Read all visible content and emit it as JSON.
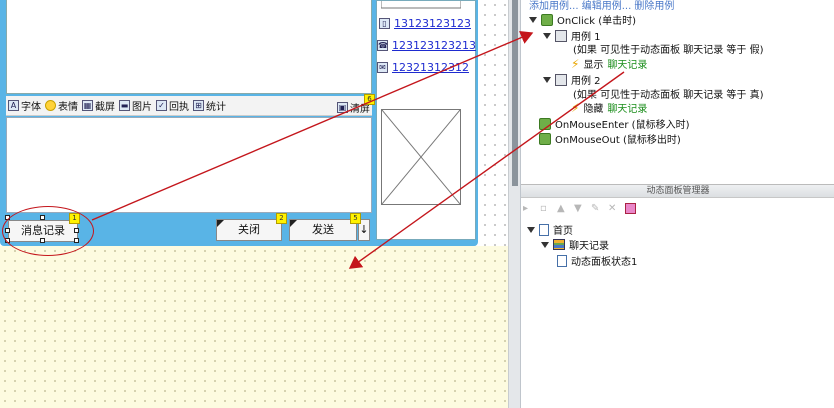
{
  "toolbar": {
    "font": "字体",
    "emoji": "表情",
    "screenshot": "截屏",
    "image": "图片",
    "receipt": "回执",
    "stats": "统计",
    "clear": "清屏"
  },
  "contacts": [
    {
      "icon": "mobile-phone-icon",
      "value": "13123123123"
    },
    {
      "icon": "telephone-icon",
      "value": "123123123213"
    },
    {
      "icon": "mail-icon",
      "value": "12321312312"
    }
  ],
  "buttons": {
    "history": "消息记录",
    "close": "关闭",
    "send": "发送",
    "send_arrow": "↓"
  },
  "markers": {
    "history": "1",
    "close": "2",
    "send": "5",
    "clear": "6"
  },
  "interaction": {
    "top_link": "添加用例... 编辑用例... 删除用例",
    "event_onclick": "OnClick (单击时)",
    "case1": "用例 1",
    "case1_condition": "(如果 可见性于动态面板 聊天记录 等于 假)",
    "case1_action_verb": "显示",
    "case1_action_target": "聊天记录",
    "case2": "用例 2",
    "case2_condition": "(如果 可见性于动态面板 聊天记录 等于 真)",
    "case2_action_verb": "隐藏",
    "case2_action_target": "聊天记录",
    "event_mouseenter": "OnMouseEnter (鼠标移入时)",
    "event_mouseout": "OnMouseOut (鼠标移出时)"
  },
  "panel_manager": {
    "title": "动态面板管理器",
    "page": "首页",
    "panel": "聊天记录",
    "state": "动态面板状态1"
  },
  "colors": {
    "accent_blue": "#59b4e6",
    "annotation_red": "#c4161c",
    "marker_yellow": "#fff200",
    "yellow_panel": "#fdfbe0"
  }
}
